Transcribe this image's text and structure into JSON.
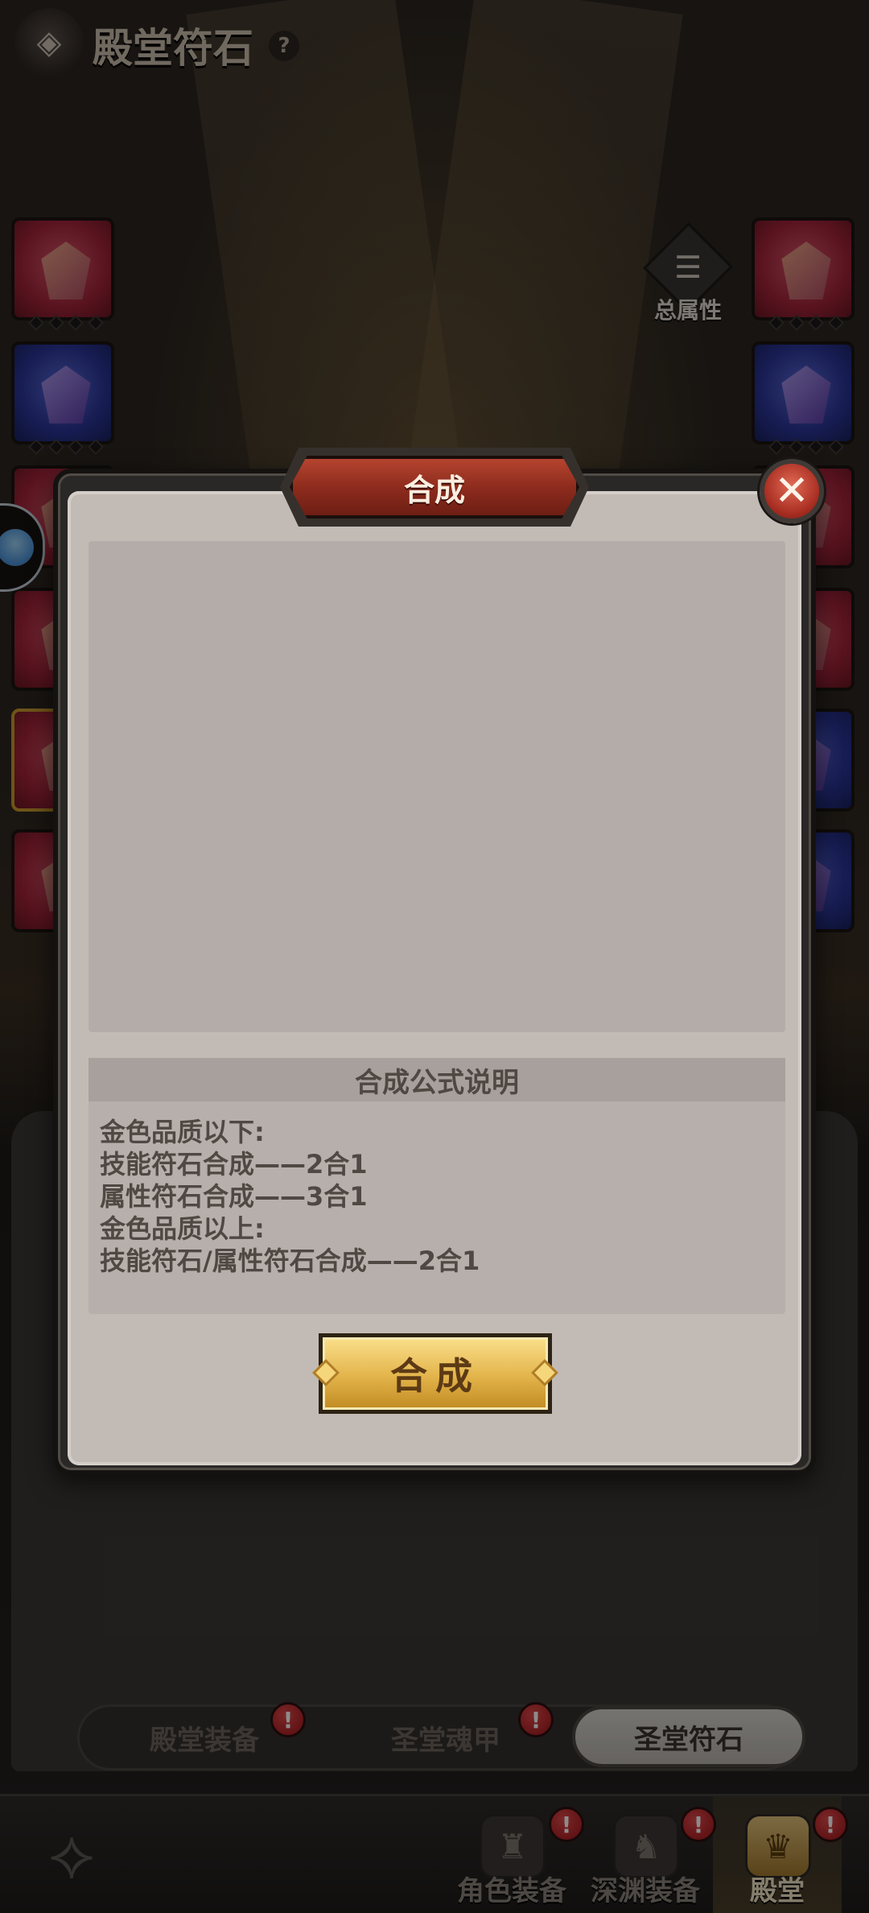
{
  "header": {
    "title": "殿堂符石",
    "help": "?"
  },
  "total_attributes": {
    "label": "总属性"
  },
  "rune_slots": {
    "left": [
      "red",
      "blue",
      "red",
      "red",
      "red",
      "red"
    ],
    "right": [
      "red",
      "blue",
      "red",
      "red",
      "blue",
      "blue"
    ]
  },
  "modal": {
    "title": "合成",
    "close": "✕",
    "formula_header": "合成公式说明",
    "formula_lines": [
      "金色品质以下:",
      "技能符石合成——2合1",
      "属性符石合成——3合1",
      "金色品质以上:",
      "技能符石/属性符石合成——2合1"
    ],
    "compose_button": "合成"
  },
  "tabs": [
    {
      "label": "殿堂装备",
      "active": false,
      "badge": "!"
    },
    {
      "label": "圣堂魂甲",
      "active": false,
      "badge": "!"
    },
    {
      "label": "圣堂符石",
      "active": true,
      "badge": ""
    }
  ],
  "bottom_nav": [
    {
      "label": "角色装备",
      "active": false,
      "badge": "!"
    },
    {
      "label": "深渊装备",
      "active": false,
      "badge": "!"
    },
    {
      "label": "殿堂",
      "active": true,
      "badge": "!"
    }
  ],
  "colors": {
    "modal_bg": "#c2bbb5",
    "banner_red": "#8a2a1c",
    "button_gold": "#e2b34a",
    "badge_red": "#c0262a"
  }
}
